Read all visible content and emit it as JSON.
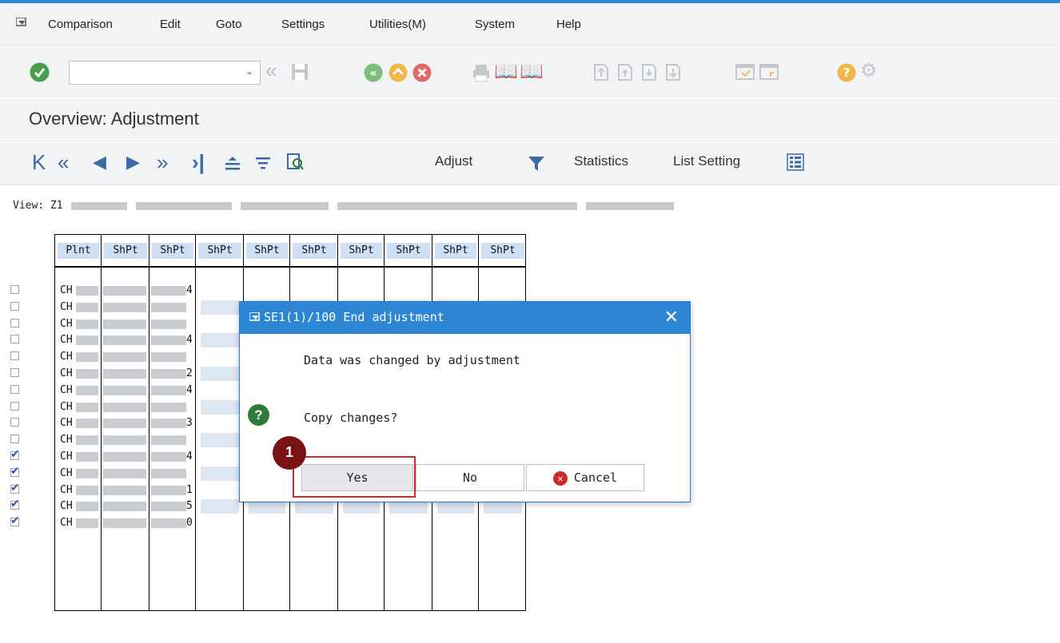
{
  "menubar": {
    "items": [
      "Comparison",
      "Edit",
      "Goto",
      "Settings",
      "Utilities(M)",
      "System",
      "Help"
    ],
    "sap_icon": "sap-menu-icon"
  },
  "toolbar": {
    "command_field_value": "",
    "icons": [
      "enter-check-icon",
      "back-double-icon",
      "save-icon",
      "back-icon",
      "exit-icon",
      "cancel-icon",
      "print-icon",
      "find-icon",
      "find-next-icon",
      "first-page-icon",
      "prev-page-icon",
      "next-page-icon",
      "last-page-icon",
      "new-session-icon",
      "shortcut-icon",
      "help-icon",
      "customize-icon"
    ]
  },
  "title": "Overview: Adjustment",
  "app_toolbar": {
    "nav_icons": [
      "first-icon",
      "prev-page-icon",
      "prev-icon",
      "next-icon",
      "next-page-icon",
      "last-icon",
      "sort-asc-icon",
      "filter-icon",
      "details-icon"
    ],
    "adjust_label": "Adjust",
    "statistics_label": "Statistics",
    "list_setting_label": "List Setting"
  },
  "view": {
    "label": "View: Z1"
  },
  "grid": {
    "headers": [
      "Plnt",
      "ShPt",
      "ShPt",
      "ShPt",
      "ShPt",
      "ShPt",
      "ShPt",
      "ShPt",
      "ShPt",
      "ShPt"
    ],
    "rows": [
      {
        "plant": "CH",
        "end": "4",
        "checked": false,
        "shaded": false
      },
      {
        "plant": "CH",
        "end": "",
        "checked": false,
        "shaded": true
      },
      {
        "plant": "CH",
        "end": "",
        "checked": false,
        "shaded": false
      },
      {
        "plant": "CH",
        "end": "4",
        "checked": false,
        "shaded": true
      },
      {
        "plant": "CH",
        "end": "",
        "checked": false,
        "shaded": false
      },
      {
        "plant": "CH",
        "end": "2",
        "checked": false,
        "shaded": true
      },
      {
        "plant": "CH",
        "end": "4",
        "checked": false,
        "shaded": false
      },
      {
        "plant": "CH",
        "end": "",
        "checked": false,
        "shaded": true
      },
      {
        "plant": "CH",
        "end": "3",
        "checked": false,
        "shaded": false
      },
      {
        "plant": "CH",
        "end": "",
        "checked": false,
        "shaded": true
      },
      {
        "plant": "CH",
        "end": "4",
        "checked": true,
        "shaded": false
      },
      {
        "plant": "CH",
        "end": "",
        "checked": true,
        "shaded": true
      },
      {
        "plant": "CH",
        "end": "1",
        "checked": true,
        "shaded": false
      },
      {
        "plant": "CH",
        "end": "5",
        "checked": true,
        "shaded": true
      },
      {
        "plant": "CH",
        "end": "0",
        "checked": true,
        "shaded": false
      }
    ]
  },
  "dialog": {
    "title": "SE1(1)/100 End adjustment",
    "message": "Data was changed by adjustment",
    "question": "Copy changes?",
    "question_icon": "question-icon",
    "yes_label": "Yes",
    "no_label": "No",
    "cancel_label": "Cancel",
    "close_icon": "close-icon"
  },
  "annotation": {
    "step_number": "1",
    "highlight_color": "#d62a2a",
    "badge_color": "#7a1414"
  },
  "colors": {
    "accent": "#2d86d3",
    "header_bg": "#cfe0f4",
    "cell_bg": "#dde6f3"
  }
}
